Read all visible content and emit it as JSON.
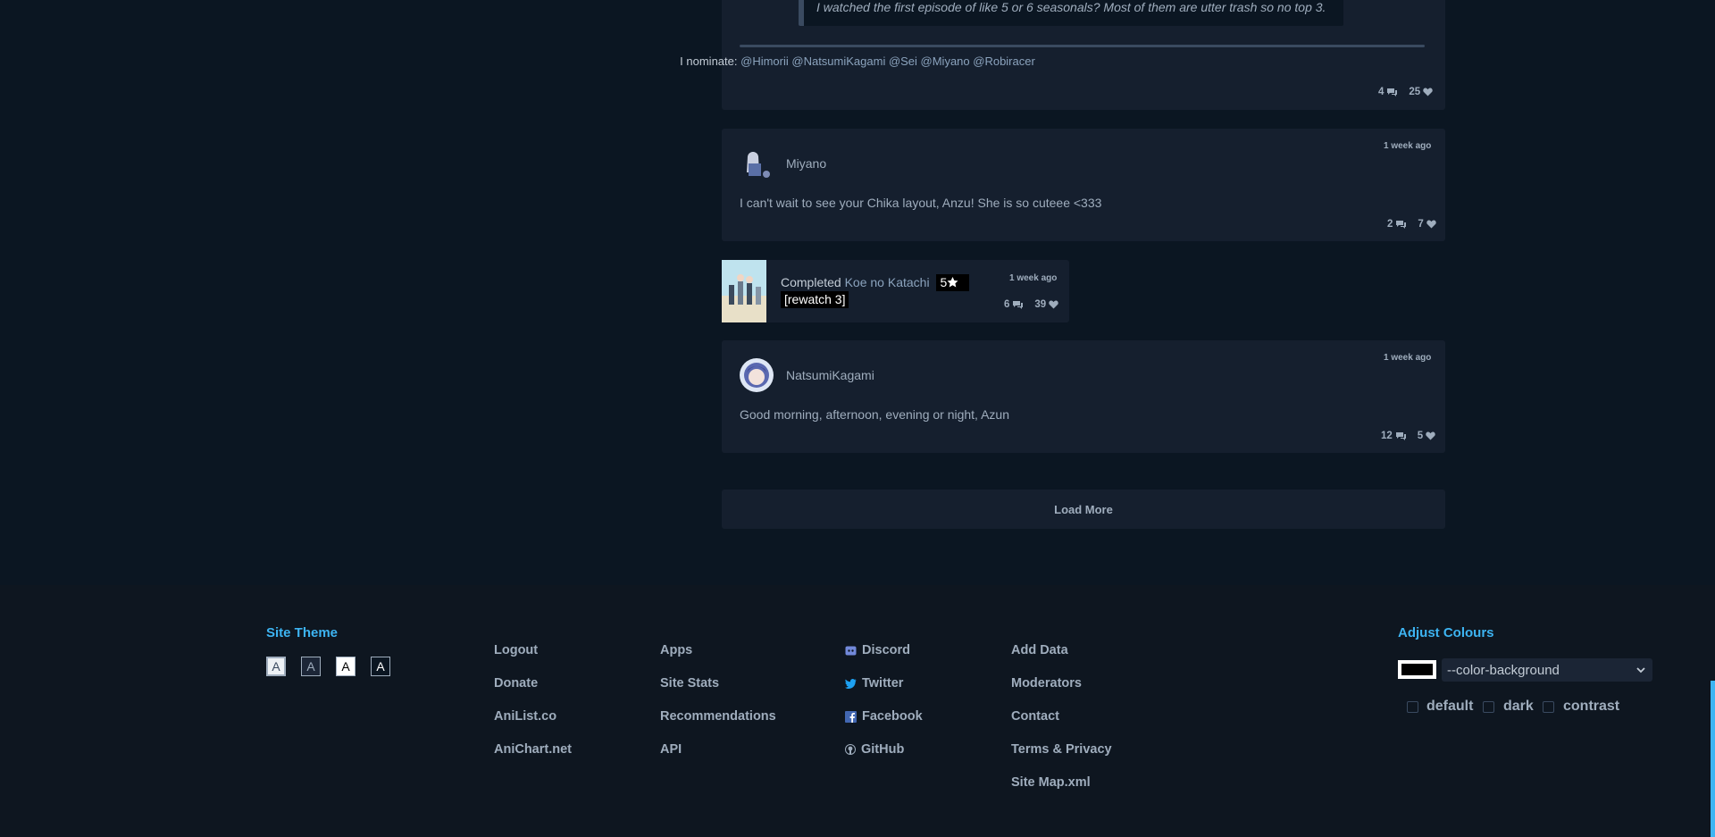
{
  "feed": {
    "post1": {
      "quote": "I watched the first episode of like 5 or 6 seasonals? Most of them are utter trash so no top 3.",
      "nominate_label": "I nominate:",
      "nominees": "@Himorii @NatsumiKagami @Sei @Miyano @Robiracer",
      "replies": "4",
      "likes": "25"
    },
    "post2": {
      "username": "Miyano",
      "time": "1 week ago",
      "text": "I can't wait to see your Chika layout, Anzu! She is so cuteee <333",
      "replies": "2",
      "likes": "7"
    },
    "activity": {
      "status": "Completed",
      "title": "Koe no Katachi",
      "score": "5",
      "note": "[rewatch 3]",
      "time": "1 week ago",
      "replies": "6",
      "likes": "39"
    },
    "post3": {
      "username": "NatsumiKagami",
      "time": "1 week ago",
      "text": "Good morning, afternoon, evening or night, Azun",
      "replies": "12",
      "likes": "5"
    },
    "load_more": "Load More"
  },
  "footer": {
    "site_theme_title": "Site Theme",
    "theme_options": [
      "A",
      "A",
      "A",
      "A"
    ],
    "col1": [
      "Logout",
      "Donate",
      "AniList.co",
      "AniChart.net"
    ],
    "col2": [
      "Apps",
      "Site Stats",
      "Recommendations",
      "API"
    ],
    "col3": [
      {
        "label": "Discord",
        "icon": "discord-icon"
      },
      {
        "label": "Twitter",
        "icon": "twitter-icon"
      },
      {
        "label": "Facebook",
        "icon": "facebook-icon"
      },
      {
        "label": "GitHub",
        "icon": "github-icon"
      }
    ],
    "col4": [
      "Add Data",
      "Moderators",
      "Contact",
      "Terms & Privacy",
      "Site Map.xml"
    ],
    "adjust_colours_title": "Adjust Colours",
    "color_select_value": "--color-background",
    "checkboxes": [
      "default",
      "dark",
      "contrast"
    ]
  },
  "colors": {
    "background": "#0b1622",
    "card": "#151f2e",
    "accent": "#3db4f2",
    "text": "#9fadbd"
  }
}
